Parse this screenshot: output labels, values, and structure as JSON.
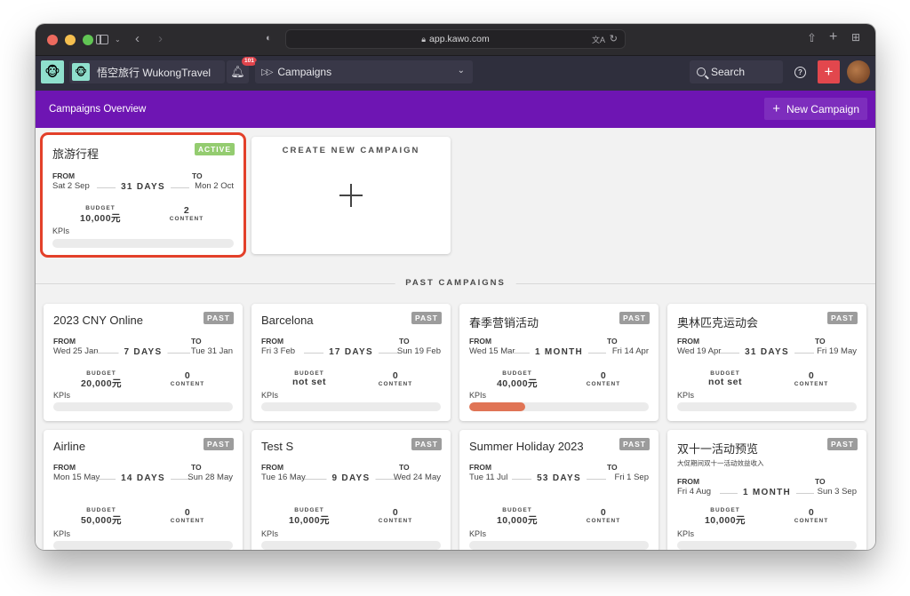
{
  "browser": {
    "url": "app.kawo.com"
  },
  "header": {
    "brand_name": "悟空旅行 WukongTravel",
    "notification_count": "101",
    "module": "Campaigns",
    "search_placeholder": "Search",
    "help_label": "?",
    "add_label": "+"
  },
  "page": {
    "title": "Campaigns Overview",
    "new_campaign_label": "New Campaign"
  },
  "labels": {
    "from": "FROM",
    "to": "TO",
    "budget": "BUDGET",
    "content": "CONTENT",
    "kpis": "KPIs",
    "create_new": "CREATE NEW CAMPAIGN",
    "past_section": "PAST CAMPAIGNS"
  },
  "active_campaign": {
    "title": "旅游行程",
    "status": "ACTIVE",
    "from": "Sat 2 Sep",
    "to": "Mon 2 Oct",
    "duration": "31 DAYS",
    "budget": "10,000元",
    "content": "2",
    "kpi_progress": 0
  },
  "past_campaigns": [
    {
      "title": "2023 CNY Online",
      "status": "PAST",
      "subtitle": "",
      "from": "Wed 25 Jan",
      "to": "Tue 31 Jan",
      "duration": "7 DAYS",
      "budget": "20,000元",
      "content": "0",
      "kpi_progress": 0
    },
    {
      "title": "Barcelona",
      "status": "PAST",
      "subtitle": "",
      "from": "Fri 3 Feb",
      "to": "Sun 19 Feb",
      "duration": "17 DAYS",
      "budget": "not set",
      "content": "0",
      "kpi_progress": 0
    },
    {
      "title": "春季营销活动",
      "status": "PAST",
      "subtitle": "",
      "from": "Wed 15 Mar",
      "to": "Fri 14 Apr",
      "duration": "1 MONTH",
      "budget": "40,000元",
      "content": "0",
      "kpi_progress": 0.31
    },
    {
      "title": "奥林匹克运动会",
      "status": "PAST",
      "subtitle": "",
      "from": "Wed 19 Apr",
      "to": "Fri 19 May",
      "duration": "31 DAYS",
      "budget": "not set",
      "content": "0",
      "kpi_progress": 0
    },
    {
      "title": "Airline",
      "status": "PAST",
      "subtitle": "",
      "from": "Mon 15 May",
      "to": "Sun 28 May",
      "duration": "14 DAYS",
      "budget": "50,000元",
      "content": "0",
      "kpi_progress": 0
    },
    {
      "title": "Test S",
      "status": "PAST",
      "subtitle": "",
      "from": "Tue 16 May",
      "to": "Wed 24 May",
      "duration": "9 DAYS",
      "budget": "10,000元",
      "content": "0",
      "kpi_progress": 0
    },
    {
      "title": "Summer Holiday 2023",
      "status": "PAST",
      "subtitle": "",
      "from": "Tue 11 Jul",
      "to": "Fri 1 Sep",
      "duration": "53 DAYS",
      "budget": "10,000元",
      "content": "0",
      "kpi_progress": 0
    },
    {
      "title": "双十一活动预览",
      "status": "PAST",
      "subtitle": "大促期间双十一活动效益收入",
      "from": "Fri 4 Aug",
      "to": "Sun 3 Sep",
      "duration": "1 MONTH",
      "budget": "10,000元",
      "content": "0",
      "kpi_progress": 0
    }
  ],
  "colors": {
    "brand_purple": "#6e15b3",
    "active_badge": "#94cc70",
    "past_badge": "#9c9c9c",
    "highlight_border": "#e3402a",
    "kpi_fill": "#e07455",
    "add_button": "#e2474d"
  }
}
